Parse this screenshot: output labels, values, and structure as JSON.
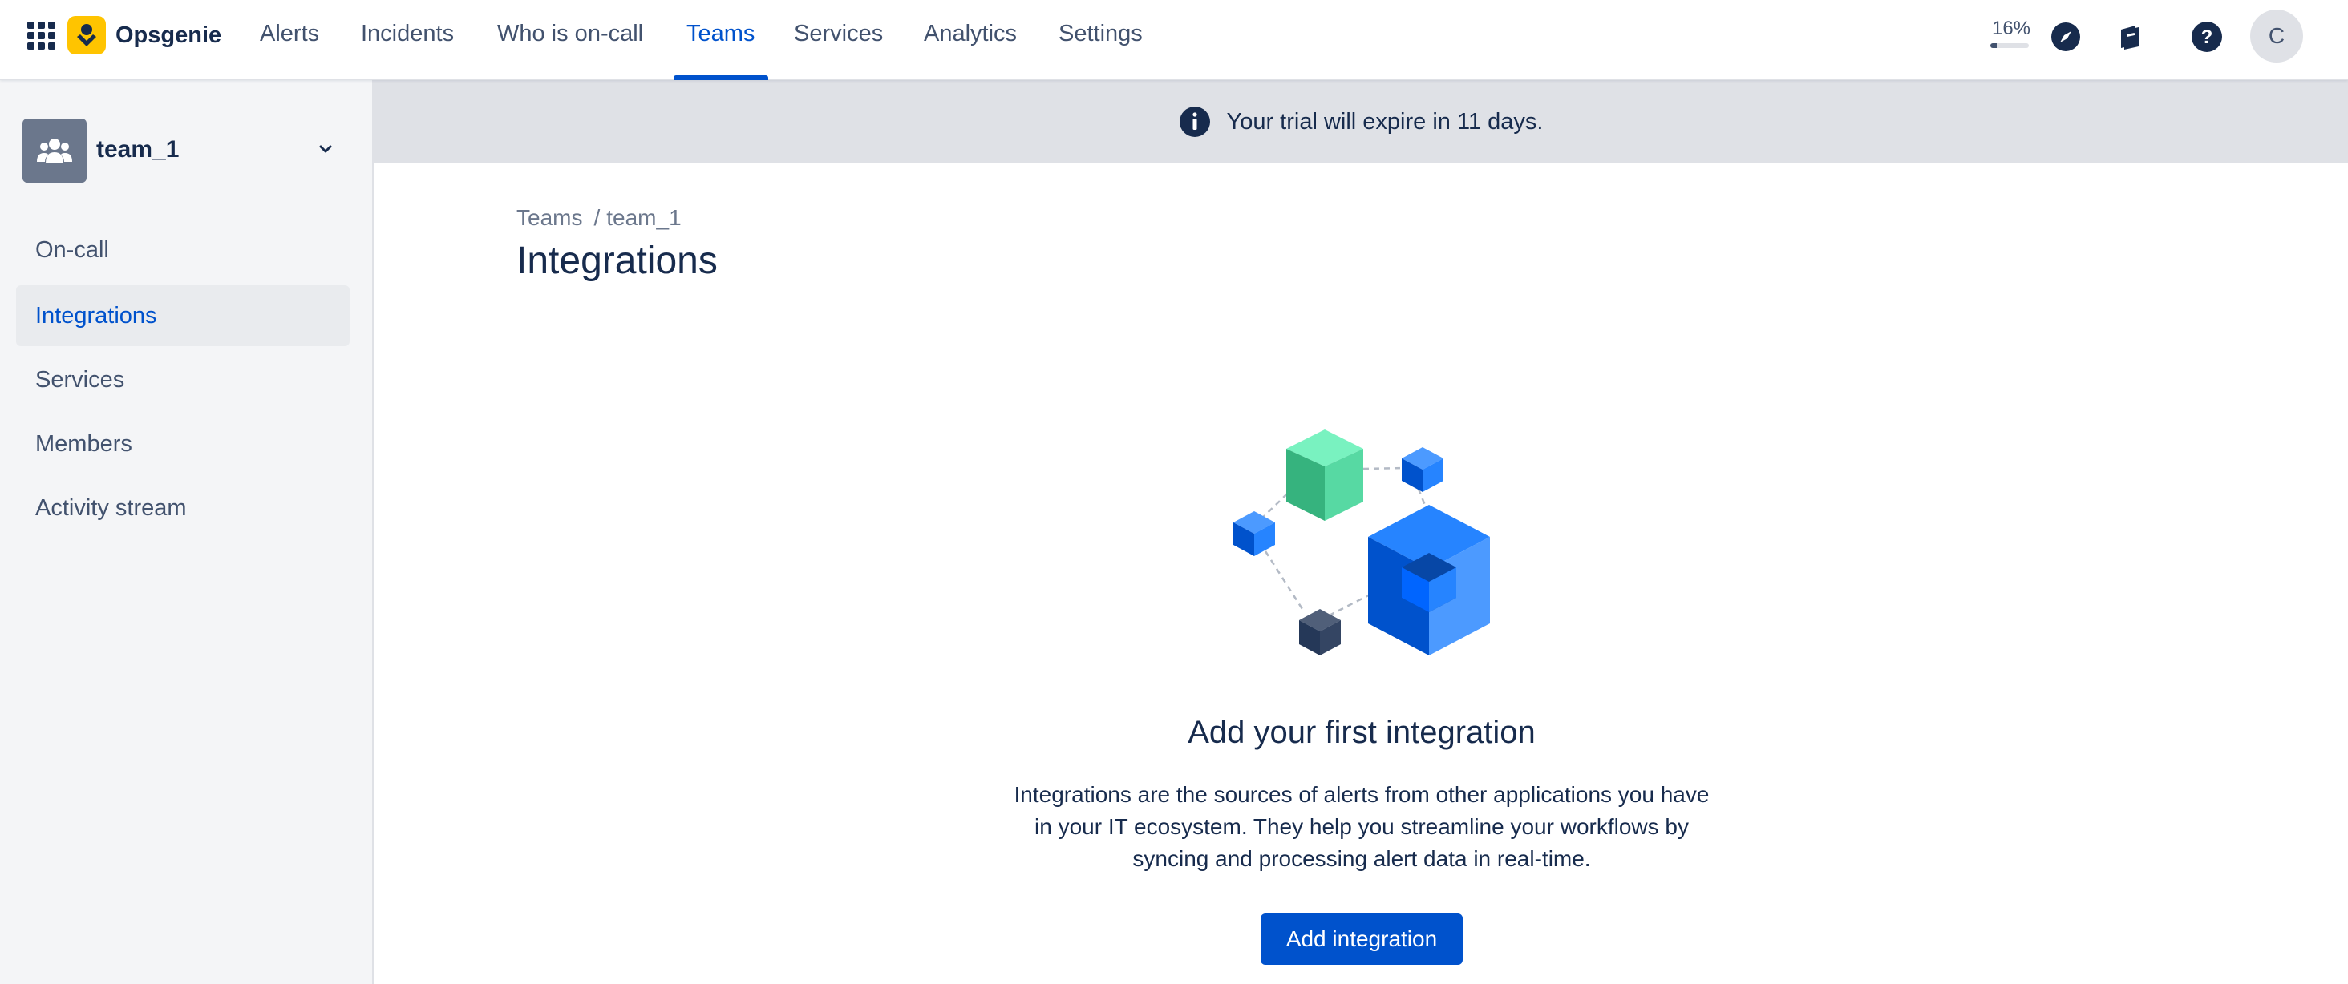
{
  "app": {
    "name": "Opsgenie"
  },
  "nav": {
    "items": [
      "Alerts",
      "Incidents",
      "Who is on-call",
      "Teams",
      "Services",
      "Analytics",
      "Settings"
    ],
    "active": "Teams"
  },
  "usage": {
    "label": "16%",
    "fraction": 0.16
  },
  "user": {
    "initial": "C"
  },
  "icons": {
    "app_switcher": "grid-icon",
    "logo": "opsgenie-logo",
    "compass": "compass-icon",
    "docs": "book-icon",
    "help": "help-icon",
    "team": "people-icon",
    "chevron": "chevron-down-icon",
    "info": "info-icon"
  },
  "sidebar": {
    "team_name": "team_1",
    "items": [
      "On-call",
      "Integrations",
      "Services",
      "Members",
      "Activity stream"
    ],
    "active": "Integrations"
  },
  "banner": {
    "text": "Your trial will expire in 11 days."
  },
  "breadcrumb": {
    "parent": "Teams",
    "separator": "/",
    "current": "team_1"
  },
  "page": {
    "title": "Integrations"
  },
  "empty_state": {
    "title": "Add your first integration",
    "description_lines": [
      "Integrations are the sources of alerts from other applications you have",
      "in your IT ecosystem. They help you streamline your workflows by",
      "syncing and processing alert data in real-time."
    ],
    "button": "Add integration"
  },
  "colors": {
    "brand_blue": "#0052cc",
    "logo_yellow": "#ffc400",
    "text_dark": "#172b4d",
    "text_subtle": "#42526e",
    "sidebar_bg": "#f4f5f7",
    "banner_bg": "#dfe1e6"
  }
}
